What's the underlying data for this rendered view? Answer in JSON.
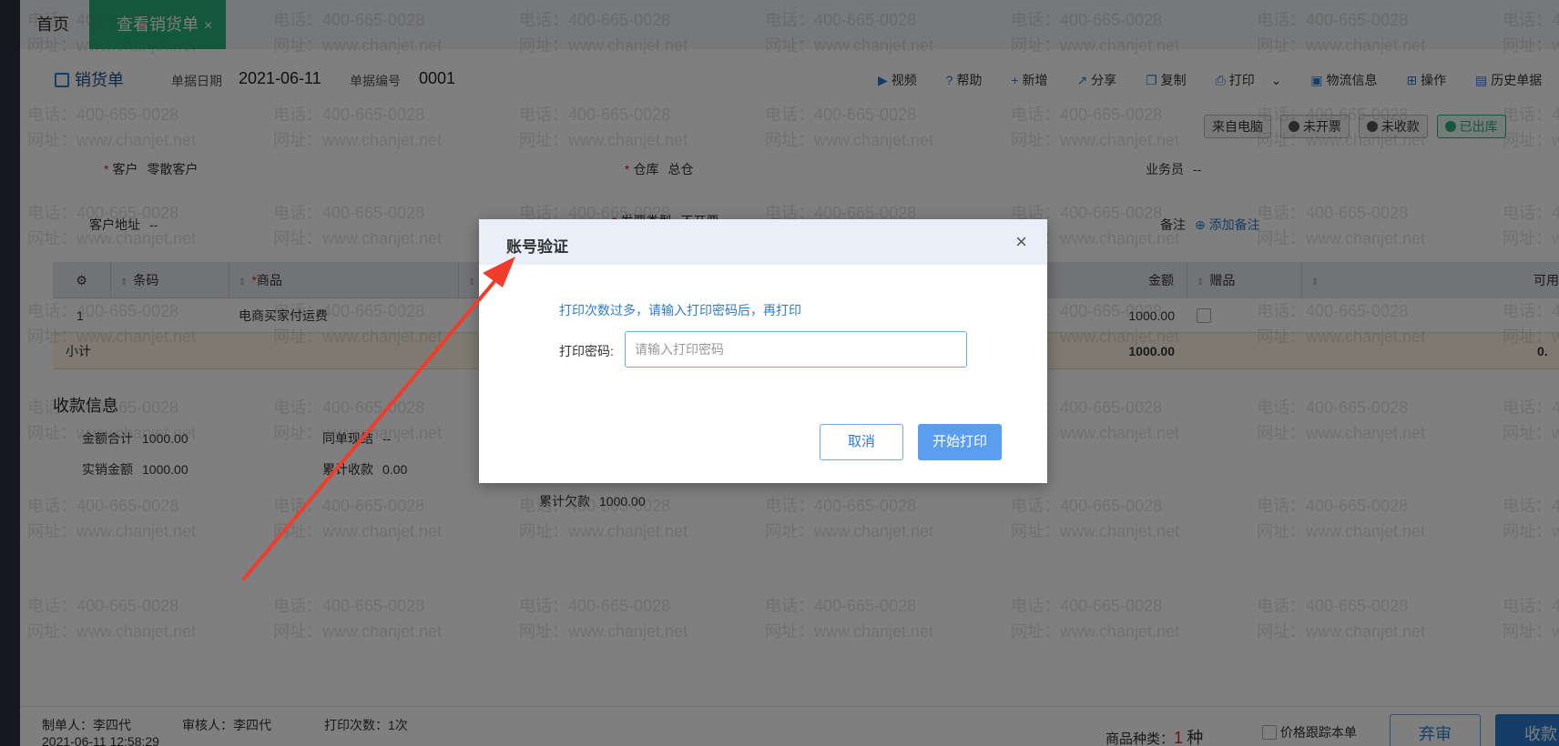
{
  "tabs": {
    "home": "首页",
    "active": "查看销货单",
    "close": "×"
  },
  "header": {
    "doc_title": "销货单",
    "date_label": "单据日期",
    "date_value": "2021-06-11",
    "no_label": "单据编号",
    "no_value": "0001"
  },
  "toolbar": {
    "video": "视频",
    "help": "帮助",
    "new": "新增",
    "share": "分享",
    "copy": "复制",
    "print": "打印",
    "logistics": "物流信息",
    "ops": "操作",
    "history": "历史单据"
  },
  "status": {
    "source": "来自电脑",
    "invoice": "未开票",
    "receipt": "未收款",
    "out": "已出库"
  },
  "form": {
    "customer_label": "客户",
    "customer_value": "零散客户",
    "warehouse_label": "仓库",
    "warehouse_value": "总仓",
    "salesman_label": "业务员",
    "salesman_value": "--",
    "address_label": "客户地址",
    "address_value": "--",
    "invoice_type_label": "发票类型",
    "invoice_type_value": "不开票",
    "remark_label": "备注",
    "remark_add": "添加备注"
  },
  "table": {
    "headers": {
      "barcode": "条码",
      "product": "商品",
      "amount": "金额",
      "gift": "赠品",
      "avail": "可用"
    },
    "row": {
      "index": "1",
      "product": "电商买家付运费",
      "amount": "1000.00"
    },
    "subtotal": {
      "label": "小计",
      "amount": "1000.00",
      "avail": "0."
    }
  },
  "payment": {
    "title": "收款信息",
    "total_label": "金额合计",
    "total_value": "1000.00",
    "cash_label": "同单现结",
    "cash_value": "--",
    "actual_label": "实销金额",
    "actual_value": "1000.00",
    "received_label": "累计收款",
    "received_value": "0.00",
    "owed_label": "累计欠款",
    "owed_value": "1000.00"
  },
  "footer": {
    "creator": "制单人：李四代",
    "auditor": "审核人：李四代",
    "print_count": "打印次数：1次",
    "created_at": "2021-06-11 12:58:29",
    "kinds_label": "商品种类：",
    "kinds_value": "1",
    "kinds_unit": "种",
    "price_track": "价格跟踪本单",
    "unaudit": "弃审",
    "collect": "收款"
  },
  "watermark": {
    "phone": "电话：400-665-0028",
    "site": "网址：www.chanjet.net"
  },
  "modal": {
    "title": "账号验证",
    "close": "×",
    "message": "打印次数过多，请输入打印密码后，再打印",
    "password_label": "打印密码:",
    "password_placeholder": "请输入打印密码",
    "cancel": "取消",
    "start_print": "开始打印"
  },
  "colors": {
    "accent": "#2d7bd0",
    "tab_green": "#27b07a",
    "primary_button": "#5b9ef0",
    "annotation_arrow": "#f03c2a"
  }
}
